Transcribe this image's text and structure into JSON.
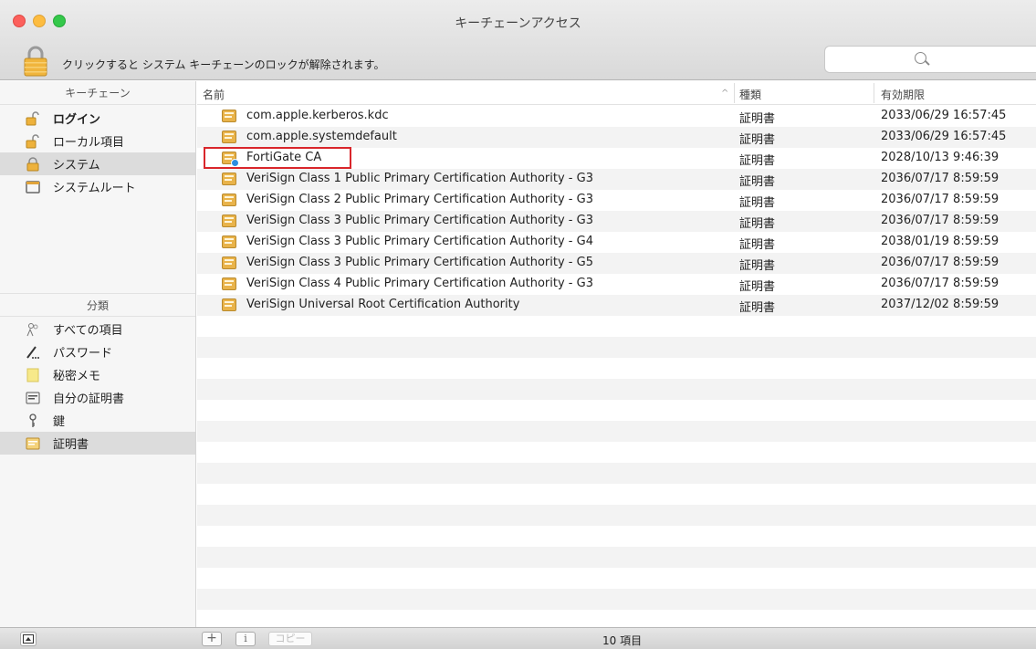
{
  "window": {
    "title": "キーチェーンアクセス"
  },
  "lock_message": "クリックすると システム キーチェーンのロックが解除されます。",
  "search": {
    "placeholder": ""
  },
  "sidebar": {
    "keychains_header": "キーチェーン",
    "keychains": [
      {
        "label": "ログイン",
        "icon": "lock-open-icon",
        "bold": true
      },
      {
        "label": "ローカル項目",
        "icon": "lock-open-icon"
      },
      {
        "label": "システム",
        "icon": "lock-closed-icon",
        "selected": true
      },
      {
        "label": "システムルート",
        "icon": "folder-icon"
      }
    ],
    "category_header": "分類",
    "categories": [
      {
        "label": "すべての項目",
        "icon": "people-icon"
      },
      {
        "label": "パスワード",
        "icon": "pencil-icon"
      },
      {
        "label": "秘密メモ",
        "icon": "note-icon"
      },
      {
        "label": "自分の証明書",
        "icon": "certificate-icon"
      },
      {
        "label": "鍵",
        "icon": "key-icon"
      },
      {
        "label": "証明書",
        "icon": "certificate-icon",
        "selected": true
      }
    ]
  },
  "table": {
    "columns": [
      "名前",
      "種類",
      "有効期限"
    ],
    "sort_indicator": "^",
    "rows": [
      {
        "name": "com.apple.kerberos.kdc",
        "kind": "証明書",
        "expires": "2033/06/29 16:57:45"
      },
      {
        "name": "com.apple.systemdefault",
        "kind": "証明書",
        "expires": "2033/06/29 16:57:45"
      },
      {
        "name": "FortiGate CA",
        "kind": "証明書",
        "expires": "2028/10/13 9:46:39",
        "highlighted": true
      },
      {
        "name": "VeriSign Class 1 Public Primary Certification Authority - G3",
        "kind": "証明書",
        "expires": "2036/07/17 8:59:59"
      },
      {
        "name": "VeriSign Class 2 Public Primary Certification Authority - G3",
        "kind": "証明書",
        "expires": "2036/07/17 8:59:59"
      },
      {
        "name": "VeriSign Class 3 Public Primary Certification Authority - G3",
        "kind": "証明書",
        "expires": "2036/07/17 8:59:59"
      },
      {
        "name": "VeriSign Class 3 Public Primary Certification Authority - G4",
        "kind": "証明書",
        "expires": "2038/01/19 8:59:59"
      },
      {
        "name": "VeriSign Class 3 Public Primary Certification Authority - G5",
        "kind": "証明書",
        "expires": "2036/07/17 8:59:59"
      },
      {
        "name": "VeriSign Class 4 Public Primary Certification Authority - G3",
        "kind": "証明書",
        "expires": "2036/07/17 8:59:59"
      },
      {
        "name": "VeriSign Universal Root Certification Authority",
        "kind": "証明書",
        "expires": "2037/12/02 8:59:59"
      }
    ]
  },
  "bottombar": {
    "add_label": "+",
    "info_label": "i",
    "copy_label": "コピー",
    "count": "10 項目"
  },
  "colors": {
    "highlight": "#d9262b",
    "cert_icon": "#e9b34a",
    "selection": "#dcdcdc"
  }
}
